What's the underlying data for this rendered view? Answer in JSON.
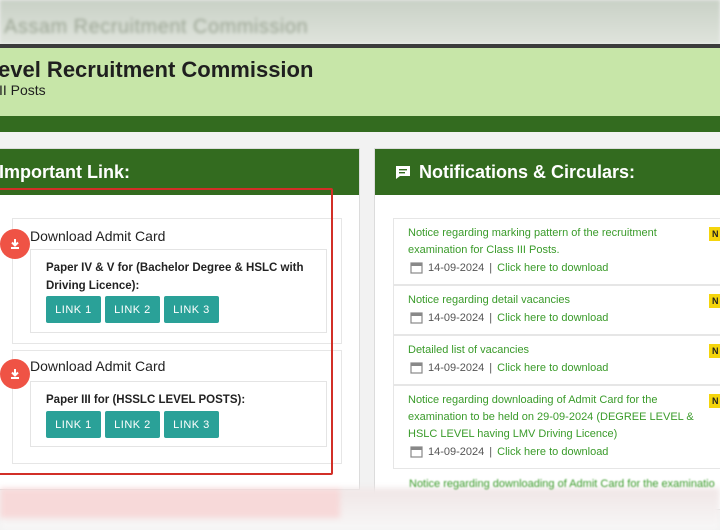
{
  "top_strip_text": "Assam Recruitment Commission",
  "header": {
    "title": "evel Recruitment Commission",
    "subtitle": "II Posts"
  },
  "important_links": {
    "heading": "Important Link:",
    "cards": [
      {
        "title": "Download Admit Card",
        "description": "Paper IV & V for (Bachelor Degree & HSLC with Driving Licence):",
        "links": [
          "LINK 1",
          "LINK 2",
          "LINK 3"
        ]
      },
      {
        "title": "Download Admit Card",
        "description": "Paper III for (HSSLC LEVEL POSTS):",
        "links": [
          "LINK 1",
          "LINK 2",
          "LINK 3"
        ]
      }
    ]
  },
  "notifications": {
    "heading": "Notifications & Circulars:",
    "new_badge": "N",
    "items": [
      {
        "text": "Notice regarding marking pattern of the recruitment examination for Class III Posts.",
        "date": "14-09-2024",
        "sep": "|",
        "link": "Click here to download"
      },
      {
        "text": "Notice regarding detail vacancies",
        "date": "14-09-2024",
        "sep": "|",
        "link": "Click here to download"
      },
      {
        "text": "Detailed list of vacancies",
        "date": "14-09-2024",
        "sep": "|",
        "link": "Click here to download"
      },
      {
        "text": "Notice regarding downloading of Admit Card for the examination to be held on 29-09-2024 (DEGREE LEVEL & HSLC LEVEL having LMV Driving Licence)",
        "date": "14-09-2024",
        "sep": "|",
        "link": "Click here to download"
      },
      {
        "text": "Notice regarding downloading of Admit Card for the examinatio"
      }
    ]
  },
  "colors": {
    "header_bg": "#c7e6a8",
    "panel_header": "#336b1f",
    "link_button": "#2aa198",
    "notification_text": "#3a9b2a",
    "download_icon": "#ef5345",
    "highlight_box": "#d22f27",
    "new_badge": "#f5d50c"
  },
  "icons": {
    "card_icon": "download-icon",
    "notifications_icon": "chat-icon",
    "date_icon": "calendar-icon"
  }
}
